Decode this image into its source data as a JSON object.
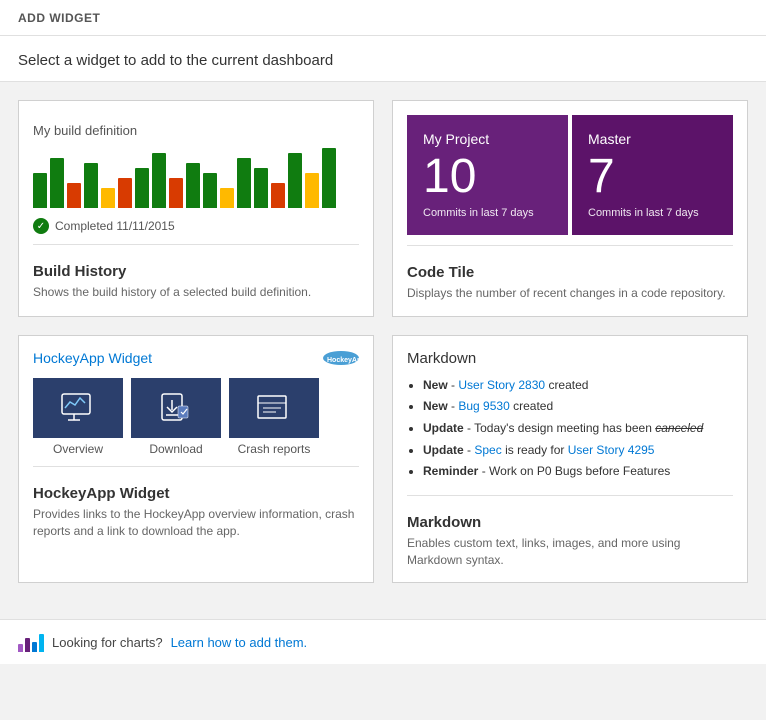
{
  "header": {
    "title": "ADD WIDGET"
  },
  "subtitle": "Select a widget to add to the current dashboard",
  "widgets": {
    "build_history": {
      "card_title": "My build definition",
      "completed_text": "Completed 11/11/2015",
      "label": "Build History",
      "description": "Shows the build history of a selected build definition.",
      "bars": [
        {
          "height": 35,
          "color": "#107c10"
        },
        {
          "height": 50,
          "color": "#107c10"
        },
        {
          "height": 25,
          "color": "#d83b01"
        },
        {
          "height": 45,
          "color": "#107c10"
        },
        {
          "height": 20,
          "color": "#ffb900"
        },
        {
          "height": 30,
          "color": "#d83b01"
        },
        {
          "height": 40,
          "color": "#107c10"
        },
        {
          "height": 55,
          "color": "#107c10"
        },
        {
          "height": 30,
          "color": "#d83b01"
        },
        {
          "height": 45,
          "color": "#107c10"
        },
        {
          "height": 35,
          "color": "#107c10"
        },
        {
          "height": 20,
          "color": "#ffb900"
        },
        {
          "height": 50,
          "color": "#107c10"
        },
        {
          "height": 40,
          "color": "#107c10"
        },
        {
          "height": 25,
          "color": "#d83b01"
        },
        {
          "height": 55,
          "color": "#107c10"
        },
        {
          "height": 35,
          "color": "#ffb900"
        },
        {
          "height": 60,
          "color": "#107c10"
        }
      ]
    },
    "code_tile": {
      "label": "Code Tile",
      "description": "Displays the number of recent changes in a code repository.",
      "tile1": {
        "title": "My Project",
        "number": "10",
        "subtitle": "Commits in last 7 days",
        "color": "#68217a"
      },
      "tile2": {
        "title": "Master",
        "number": "7",
        "subtitle": "Commits in last 7 days",
        "color": "#5c1369"
      }
    },
    "hockey_app": {
      "card_title": "HockeyApp Widget",
      "logo_text": "● HOCKEYAPP",
      "label": "HockeyApp Widget",
      "description": "Provides links to the HockeyApp overview information, crash reports and a link to download the app.",
      "icons": [
        {
          "label": "Overview"
        },
        {
          "label": "Download"
        },
        {
          "label": "Crash reports"
        }
      ]
    },
    "markdown": {
      "card_title": "Markdown",
      "label": "Markdown",
      "description": "Enables custom text, links, images, and more using Markdown syntax.",
      "items": [
        {
          "prefix": "New",
          "text": " - ",
          "link": "User Story 2830",
          "suffix": " created"
        },
        {
          "prefix": "New",
          "text": " - ",
          "link": "Bug 9530",
          "suffix": " created"
        },
        {
          "prefix": "Update",
          "text": " - Today's design meeting has been ",
          "special": "canceled",
          "suffix": ""
        },
        {
          "prefix": "Update",
          "text": " - ",
          "link1": "Spec",
          "middle": " is ready for ",
          "link2": "User Story 4295",
          "suffix": ""
        },
        {
          "prefix": "Reminder",
          "text": " - Work on P0 Bugs before Features",
          "suffix": ""
        }
      ]
    }
  },
  "footer": {
    "text": "Looking for charts?",
    "link": "Learn how to add them."
  }
}
